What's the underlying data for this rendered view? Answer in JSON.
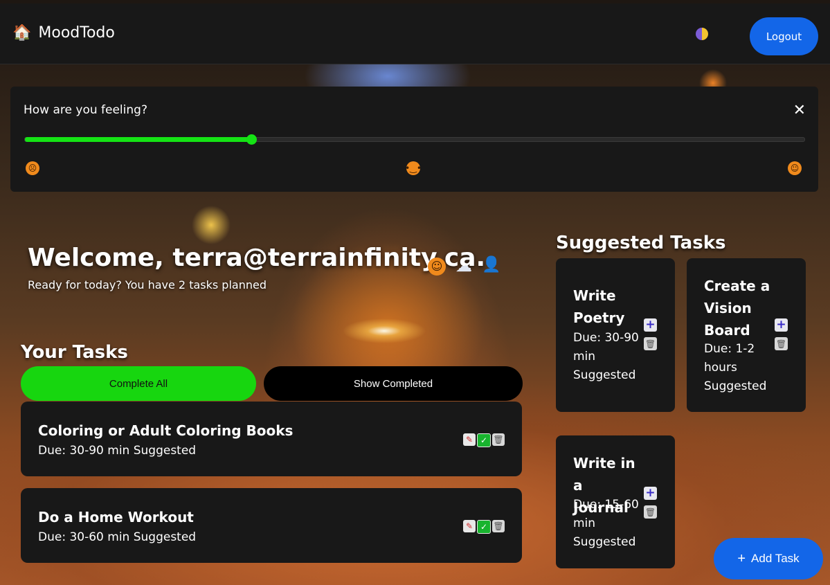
{
  "navbar": {
    "brand_icon": "house-icon",
    "brand": "MoodTodo",
    "theme_icon": "half-moon-icon",
    "logout": "Logout"
  },
  "mood": {
    "question": "How are you feeling?",
    "close": "✕",
    "level": 0.29,
    "fill_color": "#15e315",
    "emojis": [
      "sad-face-icon",
      "neutral-face-icon",
      "happy-face-icon"
    ]
  },
  "welcome": {
    "title": "Welcome, terra@terrainfinity.ca.",
    "subtitle": "Ready for today? You have 2 tasks planned",
    "status_icons": [
      "happy-face-icon",
      "weather-cloud-icon",
      "user-icon"
    ]
  },
  "tasks": {
    "heading": "Your Tasks",
    "complete_all": "Complete All",
    "show_completed": "Show Completed",
    "items": [
      {
        "title": "Coloring or Adult Coloring Books",
        "due": "Due: 30-90 min Suggested"
      },
      {
        "title": "Do a Home Workout",
        "due": "Due: 30-60 min Suggested"
      }
    ]
  },
  "suggested": {
    "heading": "Suggested Tasks",
    "items": [
      {
        "title": "Write Poetry",
        "due": "Due: 30-90 min",
        "tag": "Suggested"
      },
      {
        "title": "Create a Vision Board",
        "due": "Due: 1-2 hours",
        "tag": "Suggested"
      },
      {
        "title": "Write in a Journal",
        "due": "Due: 15-60 min",
        "tag": "Suggested"
      }
    ]
  },
  "fab": {
    "label": "Add Task",
    "plus": "+"
  },
  "colors": {
    "accent_blue": "#1366e8",
    "accent_green": "#17d60f",
    "card_bg": "#181818"
  }
}
